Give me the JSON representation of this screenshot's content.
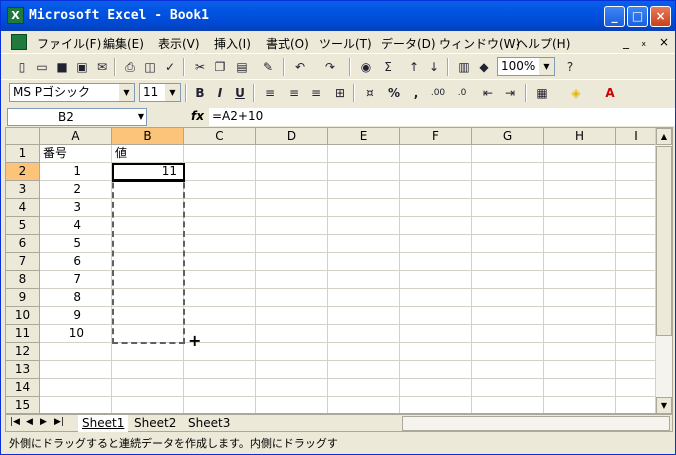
{
  "window": {
    "title": "Microsoft Excel - Book1",
    "app_icon_letter": "X",
    "min": "_",
    "max": "□",
    "close": "×"
  },
  "menu": {
    "items": [
      "ファイル(F)",
      "編集(E)",
      "表示(V)",
      "挿入(I)",
      "書式(O)",
      "ツール(T)",
      "データ(D)",
      "ウィンドウ(W)",
      "ヘルプ(H)"
    ],
    "mdi_min": "_",
    "mdi_restore": "ₓ",
    "mdi_close": "×"
  },
  "toolbar": {
    "zoom": "100%",
    "font_name": "MS Pゴシック",
    "font_size": "11",
    "bold": "B",
    "italic": "I",
    "underline": "U",
    "percent": "%",
    "comma": ",",
    "sum": "Σ",
    "help": "?",
    "dec_inc": ".00",
    "dec_dec": ".0"
  },
  "formula": {
    "cell_ref": "B2",
    "fx": "fx",
    "content": "=A2+10"
  },
  "grid": {
    "columns": [
      "A",
      "B",
      "C",
      "D",
      "E",
      "F",
      "G",
      "H",
      "I"
    ],
    "rows": [
      "1",
      "2",
      "3",
      "4",
      "5",
      "6",
      "7",
      "8",
      "9",
      "10",
      "11",
      "12",
      "13",
      "14",
      "15"
    ],
    "selected_column": "B",
    "selected_row": "2",
    "header_a": "番号",
    "header_b": "値",
    "a_values": [
      "1",
      "2",
      "3",
      "4",
      "5",
      "6",
      "7",
      "8",
      "9",
      "10"
    ],
    "b2_value": "11"
  },
  "sheets": {
    "tabs": [
      "Sheet1",
      "Sheet2",
      "Sheet3"
    ],
    "active": "Sheet1"
  },
  "status": {
    "message": "外側にドラッグすると連続データを作成します。内側にドラッグす"
  },
  "colors": {
    "title_bar": "#0053e1",
    "selected_header": "#fcc47a",
    "chrome": "#ece9d8"
  }
}
